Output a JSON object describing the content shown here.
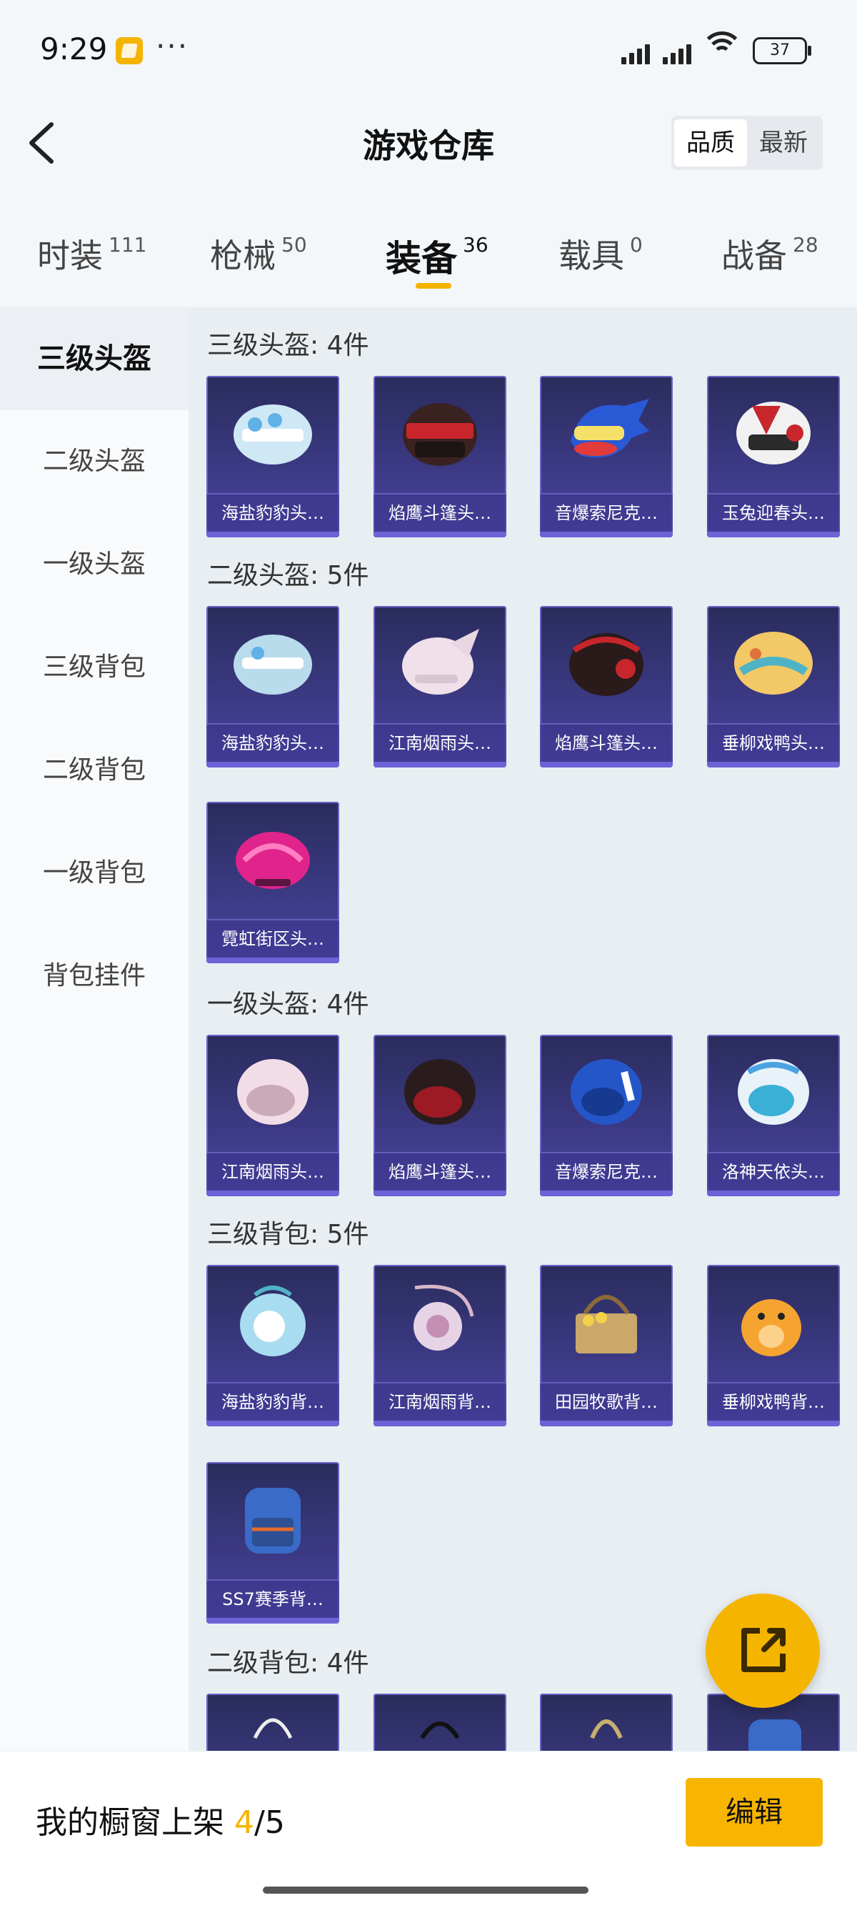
{
  "status_bar": {
    "time": "9:29",
    "more": "···",
    "battery": "37"
  },
  "header": {
    "title": "游戏仓库",
    "sort": [
      "品质",
      "最新"
    ]
  },
  "tabs": [
    {
      "label": "时装",
      "count": "111"
    },
    {
      "label": "枪械",
      "count": "50"
    },
    {
      "label": "装备",
      "count": "36"
    },
    {
      "label": "载具",
      "count": "0"
    },
    {
      "label": "战备",
      "count": "28"
    }
  ],
  "sidebar": [
    "三级头盔",
    "二级头盔",
    "一级头盔",
    "三级背包",
    "二级背包",
    "一级背包",
    "背包挂件"
  ],
  "sections": [
    {
      "title": "三级头盔: 4件",
      "items": [
        "海盐豹豹头…",
        "焰鹰斗篷头…",
        "音爆索尼克…",
        "玉兔迎春头…"
      ]
    },
    {
      "title": "二级头盔: 5件",
      "items": [
        "海盐豹豹头…",
        "江南烟雨头…",
        "焰鹰斗篷头…",
        "垂柳戏鸭头…",
        "霓虹街区头…"
      ]
    },
    {
      "title": "一级头盔: 4件",
      "items": [
        "江南烟雨头…",
        "焰鹰斗篷头…",
        "音爆索尼克…",
        "洛神天依头…"
      ]
    },
    {
      "title": "三级背包: 5件",
      "items": [
        "海盐豹豹背…",
        "江南烟雨背…",
        "田园牧歌背…",
        "垂柳戏鸭背…",
        "SS7赛季背…"
      ]
    },
    {
      "title": "二级背包: 4件",
      "items": [
        "",
        "",
        "",
        ""
      ]
    }
  ],
  "bottom_bar": {
    "label": "我的橱窗上架",
    "current": "4",
    "total": "/5",
    "edit": "编辑"
  },
  "colors": {
    "accent": "#f5b400",
    "card_bg": "#3d3a86"
  }
}
